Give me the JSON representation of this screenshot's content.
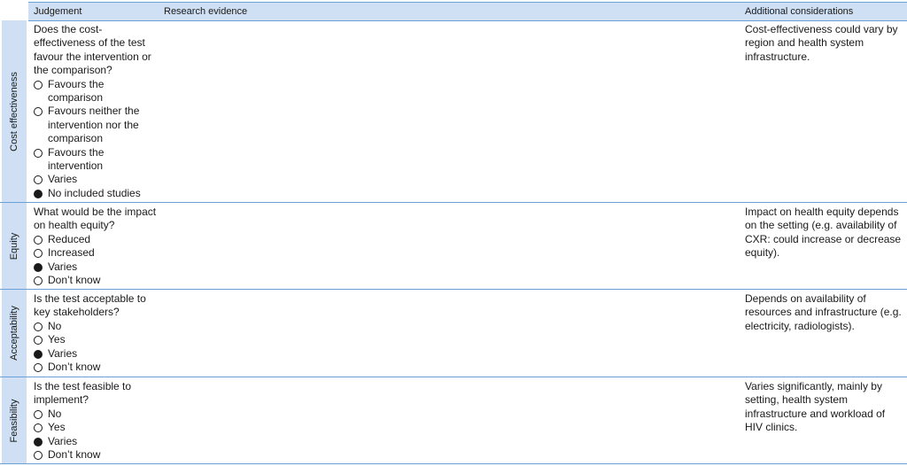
{
  "header": {
    "judgement": "Judgement",
    "research_evidence": "Research evidence",
    "additional_considerations": "Additional considerations"
  },
  "rows": [
    {
      "label": "Cost effectiveness",
      "question": "Does the cost-effectiveness of the test favour the intervention or the comparison?",
      "options": [
        {
          "text": "Favours the comparison",
          "selected": false
        },
        {
          "text": "Favours neither the intervention nor the comparison",
          "selected": false
        },
        {
          "text": "Favours the intervention",
          "selected": false
        },
        {
          "text": "Varies",
          "selected": false
        },
        {
          "text": "No included studies",
          "selected": true
        }
      ],
      "consideration": "Cost-effectiveness could vary by region and health system infrastructure."
    },
    {
      "label": "Equity",
      "question": "What would be the impact on health equity?",
      "options": [
        {
          "text": "Reduced",
          "selected": false
        },
        {
          "text": "Increased",
          "selected": false
        },
        {
          "text": "Varies",
          "selected": true
        },
        {
          "text": "Don’t know",
          "selected": false
        }
      ],
      "consideration": "Impact on health equity depends on the setting (e.g. availability of CXR: could increase or decrease equity)."
    },
    {
      "label": "Acceptability",
      "question": "Is the test acceptable to key stakeholders?",
      "options": [
        {
          "text": "No",
          "selected": false
        },
        {
          "text": "Yes",
          "selected": false
        },
        {
          "text": "Varies",
          "selected": true
        },
        {
          "text": "Don’t know",
          "selected": false
        }
      ],
      "consideration": "Depends on availability of resources and infrastructure (e.g. electricity, radiologists)."
    },
    {
      "label": "Feasibility",
      "question": "Is the test feasible to implement?",
      "options": [
        {
          "text": "No",
          "selected": false
        },
        {
          "text": "Yes",
          "selected": false
        },
        {
          "text": "Varies",
          "selected": true
        },
        {
          "text": "Don’t know",
          "selected": false
        }
      ],
      "consideration": "Varies significantly, mainly by setting, health system infrastructure and workload of HIV clinics."
    }
  ]
}
